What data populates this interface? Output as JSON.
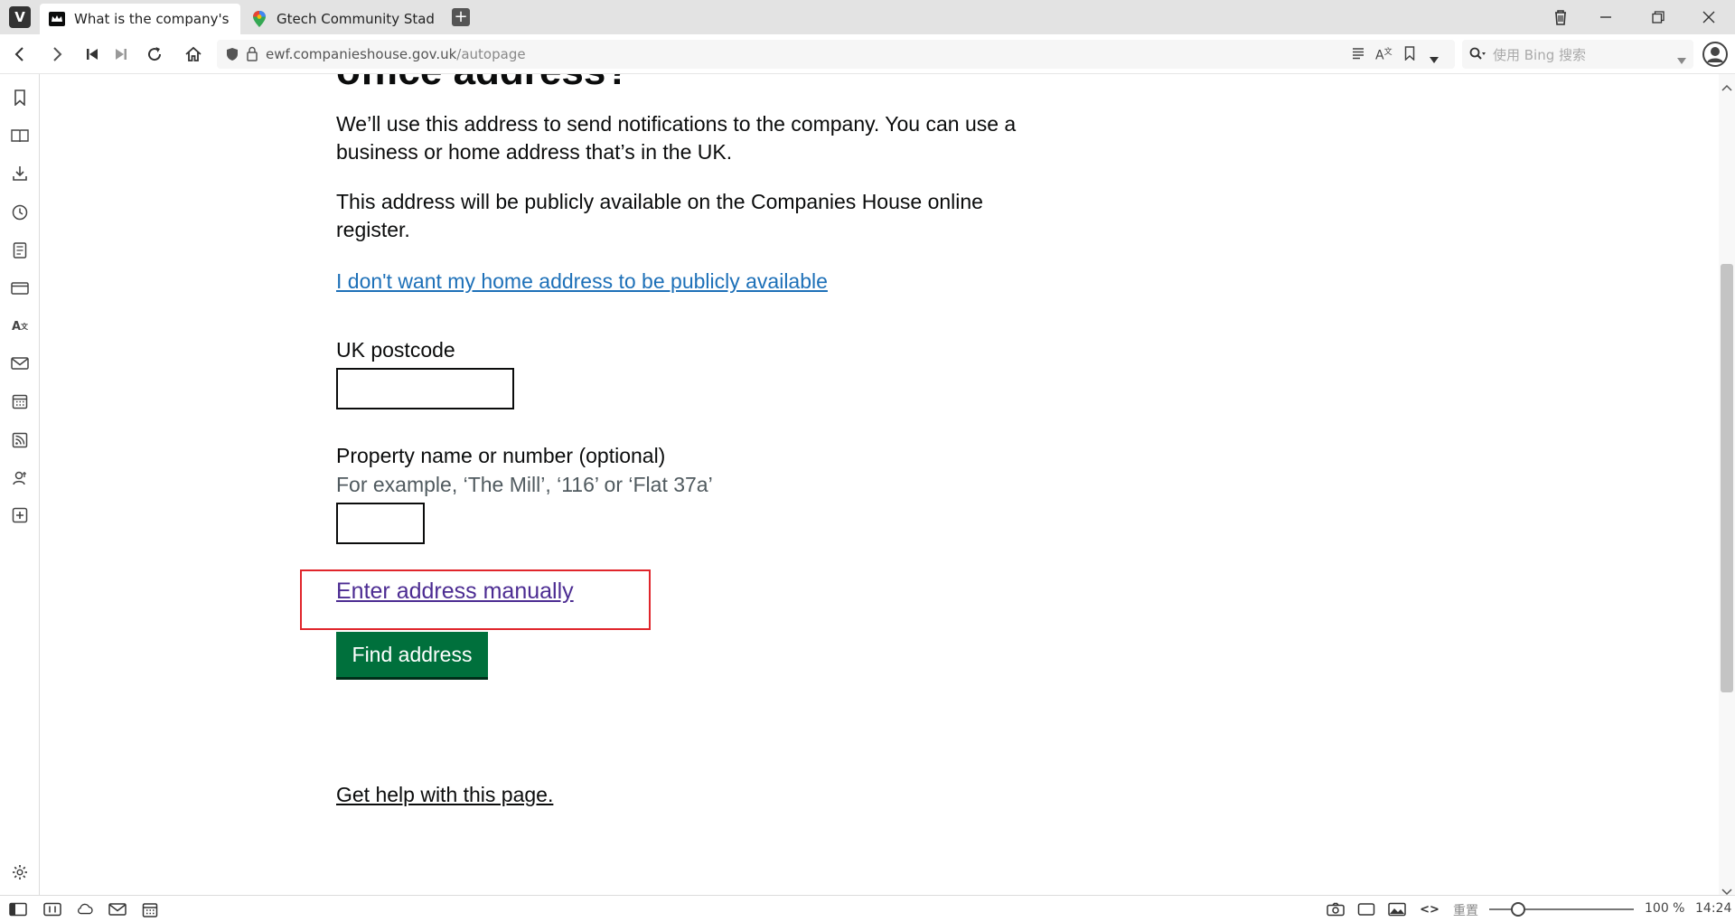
{
  "browser": {
    "tabs": [
      {
        "title": "What is the company's regi",
        "favicon": "companies-house-crown-icon",
        "active": true
      },
      {
        "title": "Gtech Community Stadium",
        "favicon": "google-maps-pin-icon",
        "active": false
      }
    ],
    "url_host": "ewf.companieshouse.gov.uk",
    "url_path": "/autopage",
    "search_placeholder": "使用 Bing 搜索"
  },
  "page": {
    "heading_partial": "office address?",
    "intro_text": "We’ll use this address to send notifications to the company. You can use a business or home address that’s in the UK.",
    "public_text": "This address will be publicly available on the Companies House online register.",
    "privacy_link": "I don't want my home address to be publicly available",
    "postcode_label": "UK postcode",
    "postcode_value": "",
    "property_label": "Property name or number (optional)",
    "property_hint": "For example, ‘The Mill’, ‘116’ or ‘Flat 37a’",
    "property_value": "",
    "manual_link": "Enter address manually",
    "find_button": "Find address",
    "help_link": "Get help with this page."
  },
  "statusbar": {
    "reset_label": "重置",
    "zoom": "100 %",
    "time": "14:24"
  },
  "colors": {
    "link_blue": "#1d70b8",
    "visited_purple": "#4c2c92",
    "button_green": "#00703c",
    "highlight_red": "#e0252b"
  }
}
